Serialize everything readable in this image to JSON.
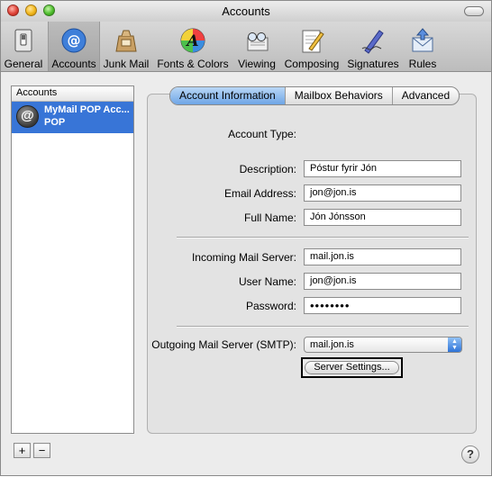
{
  "window": {
    "title": "Accounts"
  },
  "toolbar": {
    "items": [
      {
        "label": "General",
        "icon": "general-switch-icon"
      },
      {
        "label": "Accounts",
        "icon": "at-sign-icon"
      },
      {
        "label": "Junk Mail",
        "icon": "junk-bag-icon"
      },
      {
        "label": "Fonts & Colors",
        "icon": "font-palette-icon"
      },
      {
        "label": "Viewing",
        "icon": "glasses-icon"
      },
      {
        "label": "Composing",
        "icon": "pencil-paper-icon"
      },
      {
        "label": "Signatures",
        "icon": "pen-signature-icon"
      },
      {
        "label": "Rules",
        "icon": "rules-envelope-icon"
      }
    ],
    "selected": "Accounts"
  },
  "accounts": {
    "header": "Accounts",
    "items": [
      {
        "name": "MyMail POP Acc...",
        "type": "POP"
      }
    ],
    "add_label": "+",
    "remove_label": "−"
  },
  "tabs": [
    {
      "label": "Account Information",
      "active": true
    },
    {
      "label": "Mailbox Behaviors",
      "active": false
    },
    {
      "label": "Advanced",
      "active": false
    }
  ],
  "form": {
    "account_type_label": "Account Type:",
    "account_type_value": "",
    "description_label": "Description:",
    "description_value": "Póstur fyrir Jón",
    "email_label": "Email Address:",
    "email_value": "jon@jon.is",
    "fullname_label": "Full Name:",
    "fullname_value": "Jón Jónsson",
    "incoming_label": "Incoming Mail Server:",
    "incoming_value": "mail.jon.is",
    "username_label": "User Name:",
    "username_value": "jon@jon.is",
    "password_label": "Password:",
    "password_value": "••••••••",
    "smtp_label": "Outgoing Mail Server (SMTP):",
    "smtp_value": "mail.jon.is",
    "server_settings_label": "Server Settings..."
  },
  "help_label": "?",
  "colors": {
    "selection": "#3875d7",
    "active_tab": "#6ea5e6"
  }
}
